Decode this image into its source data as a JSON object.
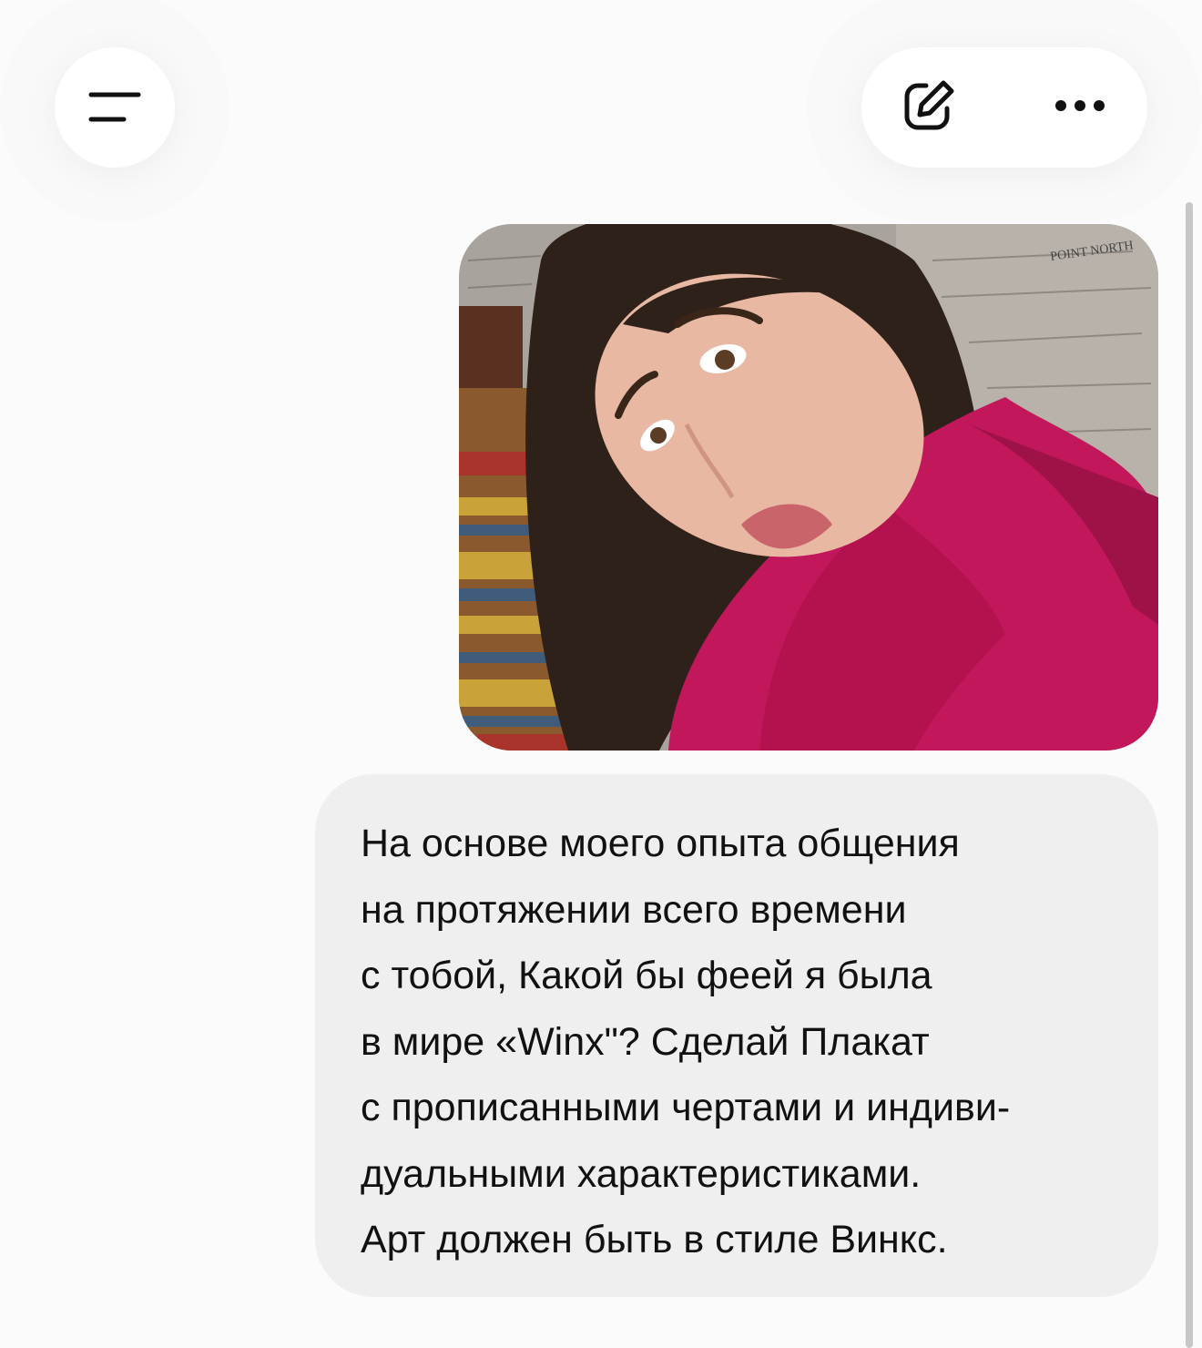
{
  "header": {
    "menu_icon": "menu-icon",
    "edit_icon": "edit-icon",
    "more_icon": "more-horizontal-icon"
  },
  "message": {
    "image": "user-selfie-photo",
    "lines": [
      "На основе моего опыта общения",
      "на протяжении всего времени",
      "с тобой, Какой бы феей я была",
      "в мире «Winx\"? Сделай Плакат",
      "с прописанными чертами и индиви-",
      "дуальными характеристиками.",
      "Арт должен быть в стиле Винкс."
    ]
  },
  "colors": {
    "background": "#fbfbfb",
    "bubble": "#efefef",
    "text": "#111111",
    "sweater": "#c2185b"
  }
}
